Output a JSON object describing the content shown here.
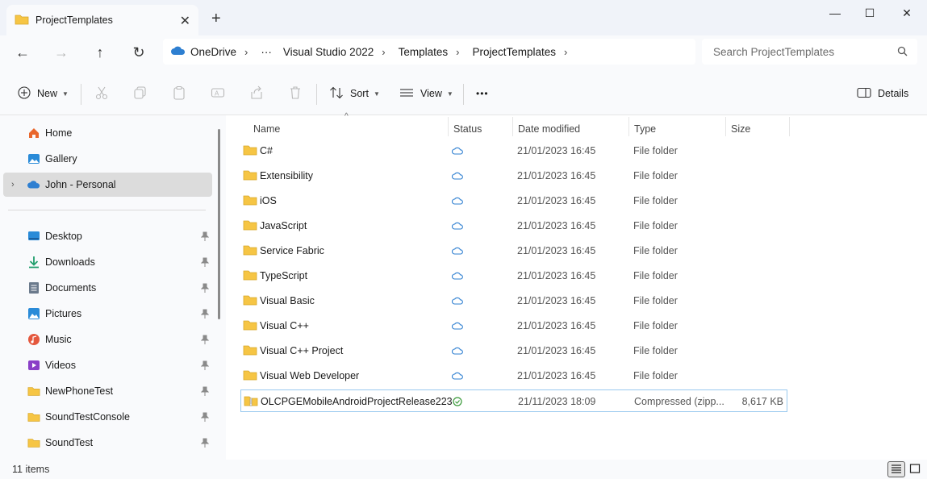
{
  "window": {
    "tab_title": "ProjectTemplates",
    "tab_close": "✕",
    "new_tab": "+",
    "minimize": "—",
    "maximize": "☐",
    "close": "✕"
  },
  "nav_buttons": {
    "back": "←",
    "forward": "→",
    "up": "↑",
    "refresh": "↻"
  },
  "address": {
    "root": "OneDrive",
    "ellipsis": "···",
    "crumbs": [
      "Visual Studio 2022",
      "Templates",
      "ProjectTemplates"
    ]
  },
  "search": {
    "placeholder": "Search ProjectTemplates"
  },
  "commands": {
    "new": "New",
    "sort": "Sort",
    "view": "View",
    "more": "•••",
    "details": "Details"
  },
  "sidebar": {
    "items": [
      {
        "label": "Home",
        "icon": "home-icon"
      },
      {
        "label": "Gallery",
        "icon": "gallery-icon"
      },
      {
        "label": "John - Personal",
        "icon": "cloud-icon"
      }
    ],
    "quick_access": [
      {
        "label": "Desktop",
        "icon": "desktop-icon"
      },
      {
        "label": "Downloads",
        "icon": "downloads-icon"
      },
      {
        "label": "Documents",
        "icon": "documents-icon"
      },
      {
        "label": "Pictures",
        "icon": "pictures-icon"
      },
      {
        "label": "Music",
        "icon": "music-icon"
      },
      {
        "label": "Videos",
        "icon": "videos-icon"
      },
      {
        "label": "NewPhoneTest",
        "icon": "folder-icon"
      },
      {
        "label": "SoundTestConsole",
        "icon": "folder-icon"
      },
      {
        "label": "SoundTest",
        "icon": "folder-icon"
      }
    ]
  },
  "columns": {
    "name": "Name",
    "status": "Status",
    "date": "Date modified",
    "type": "Type",
    "size": "Size"
  },
  "files": [
    {
      "name": "C#",
      "date": "21/01/2023 16:45",
      "type": "File folder",
      "size": ""
    },
    {
      "name": "Extensibility",
      "date": "21/01/2023 16:45",
      "type": "File folder",
      "size": ""
    },
    {
      "name": "iOS",
      "date": "21/01/2023 16:45",
      "type": "File folder",
      "size": ""
    },
    {
      "name": "JavaScript",
      "date": "21/01/2023 16:45",
      "type": "File folder",
      "size": ""
    },
    {
      "name": "Service Fabric",
      "date": "21/01/2023 16:45",
      "type": "File folder",
      "size": ""
    },
    {
      "name": "TypeScript",
      "date": "21/01/2023 16:45",
      "type": "File folder",
      "size": ""
    },
    {
      "name": "Visual Basic",
      "date": "21/01/2023 16:45",
      "type": "File folder",
      "size": ""
    },
    {
      "name": "Visual C++",
      "date": "21/01/2023 16:45",
      "type": "File folder",
      "size": ""
    },
    {
      "name": "Visual C++ Project",
      "date": "21/01/2023 16:45",
      "type": "File folder",
      "size": ""
    },
    {
      "name": "Visual Web Developer",
      "date": "21/01/2023 16:45",
      "type": "File folder",
      "size": ""
    },
    {
      "name": "OLCPGEMobileAndroidProjectRelease223",
      "date": "21/11/2023 18:09",
      "type": "Compressed (zipp...",
      "size": "8,617 KB"
    }
  ],
  "status_bar": {
    "count": "11 items"
  },
  "colors": {
    "folder": "#f6c544",
    "cloud": "#2e7fd1",
    "synced": "#3a9a3a",
    "selected_border": "#99c9ef"
  }
}
